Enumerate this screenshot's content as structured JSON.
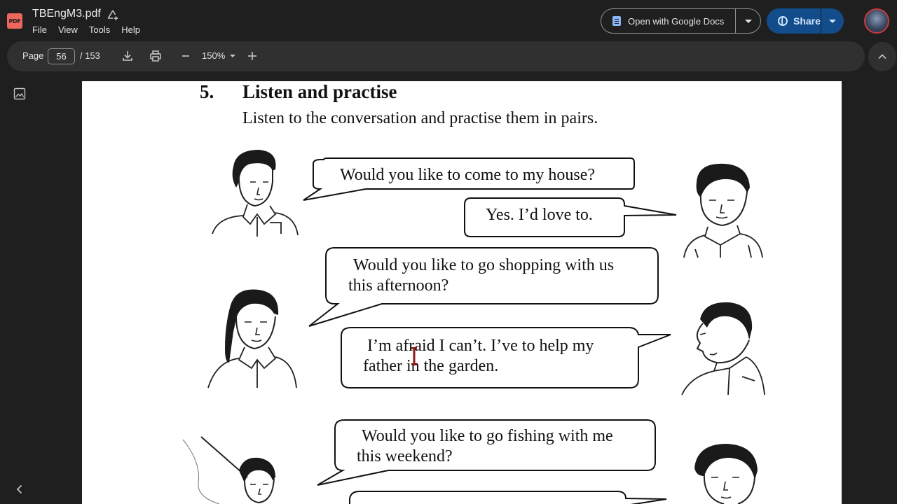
{
  "app": {
    "file_name": "TBEngM3.pdf",
    "menu": [
      "File",
      "View",
      "Tools",
      "Help"
    ],
    "open_with_label": "Open with Google Docs",
    "share_label": "Share",
    "badge_text": "PDF"
  },
  "toolbar": {
    "page_label": "Page",
    "current_page": "56",
    "total_pages": "/ 153",
    "zoom": "150%"
  },
  "document": {
    "section_number": "5.",
    "section_title": "Listen and practise",
    "instruction": "Listen to the conversation and practise them in pairs.",
    "bubbles": [
      {
        "lines": [
          "Would you like to come to my house?"
        ]
      },
      {
        "lines": [
          "Yes. I’d love to."
        ]
      },
      {
        "lines": [
          "Would you like to go shopping with us",
          "this afternoon?"
        ]
      },
      {
        "lines": [
          "I’m afraid I can’t. I’ve to help my",
          "father in the garden."
        ]
      },
      {
        "lines": [
          "Would you like to go fishing with me",
          "this weekend?"
        ]
      }
    ]
  },
  "icons": {
    "cloud_save": "drive-add-icon",
    "download": "download-icon",
    "print": "print-icon",
    "zoom_out": "minus-icon",
    "zoom_in": "plus-icon",
    "collapse": "chevron-up-icon",
    "thumbnails": "image-icon",
    "sidebar": "chevron-left-icon",
    "text_cursor": "text-cursor-icon"
  },
  "colors": {
    "pdf_badge": "#ee675c",
    "share_button": "#124c8a",
    "background": "#1f1f1f",
    "toolbar": "#303030",
    "cursor": "#8b1a1a"
  }
}
